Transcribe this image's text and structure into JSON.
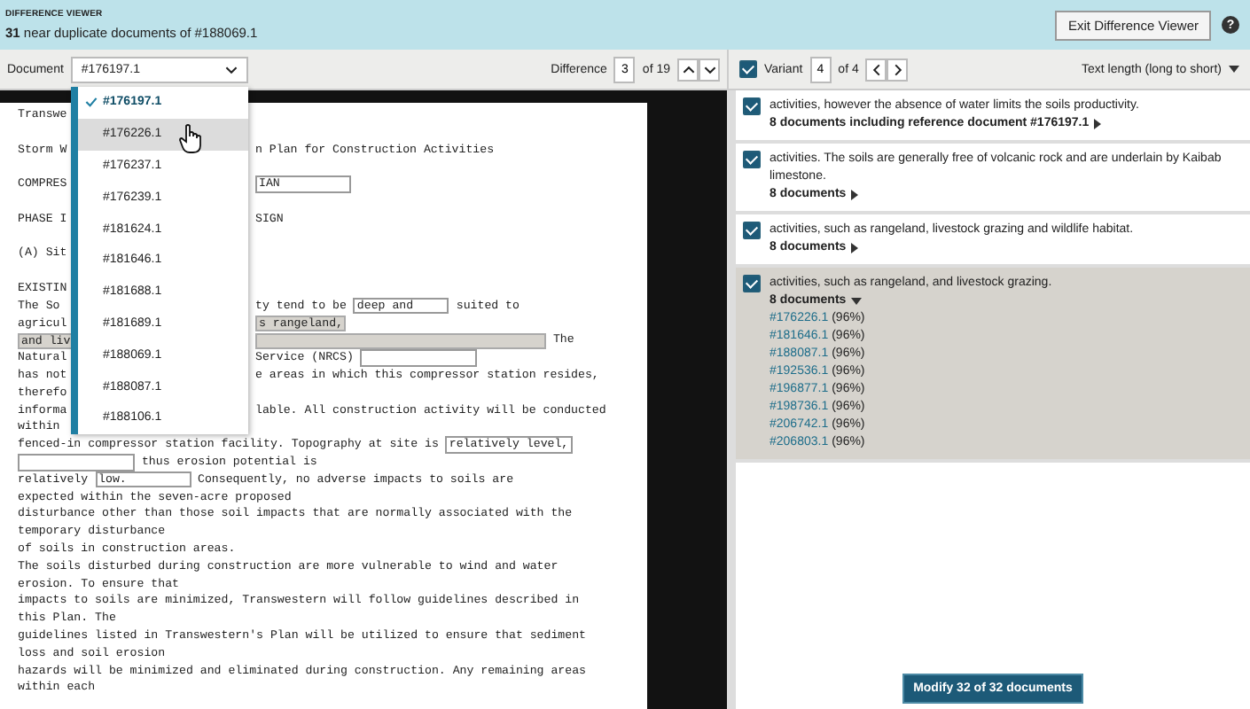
{
  "header": {
    "eyebrow": "DIFFERENCE VIEWER",
    "subtitle": "**31** near duplicate documents of #188069.1",
    "exit_button": "Exit Difference Viewer",
    "help": "?"
  },
  "toolbar": {
    "document_label": "Document",
    "document_value": "#176197.1",
    "difference_label": "Difference",
    "difference_value": "3",
    "difference_total": "of 19"
  },
  "variant_bar": {
    "checked": true,
    "label": "Variant",
    "value": "4",
    "total": "of 4",
    "sort": "Text length (long to short)"
  },
  "document_menu": [
    {
      "label": "#176197.1",
      "selected": true,
      "hovered": false
    },
    {
      "label": "#176226.1",
      "selected": false,
      "hovered": true
    },
    {
      "label": "#176237.1",
      "selected": false,
      "hovered": false
    },
    {
      "label": "#176239.1",
      "selected": false,
      "hovered": false
    },
    {
      "label": "#181624.1",
      "selected": false,
      "hovered": false
    },
    {
      "label": "#181646.1",
      "selected": false,
      "hovered": false
    },
    {
      "label": "#181688.1",
      "selected": false,
      "hovered": false
    },
    {
      "label": "#181689.1",
      "selected": false,
      "hovered": false
    },
    {
      "label": "#188069.1",
      "selected": false,
      "hovered": false
    },
    {
      "label": "#188087.1",
      "selected": false,
      "hovered": false
    },
    {
      "label": "#188106.1",
      "selected": false,
      "hovered": false
    }
  ],
  "document_lines": [
    {
      "kind": "split",
      "left": [
        {
          "kind": "plain",
          "text": "Transwe"
        }
      ]
    },
    {
      "kind": "blank"
    },
    {
      "kind": "split",
      "left": [
        {
          "kind": "plain",
          "text": "Storm W"
        }
      ],
      "right": [
        {
          "kind": "plain",
          "text": "n Plan for Construction Activities"
        }
      ]
    },
    {
      "kind": "blank"
    },
    {
      "kind": "split",
      "left": [
        {
          "kind": "plain",
          "text": "COMPRES"
        }
      ],
      "right": [
        {
          "kind": "box",
          "text": "IAN"
        }
      ]
    },
    {
      "kind": "blank"
    },
    {
      "kind": "split",
      "left": [
        {
          "kind": "plain",
          "text": "PHASE I"
        }
      ],
      "right": [
        {
          "kind": "plain",
          "text": "SIGN"
        }
      ]
    },
    {
      "kind": "blank"
    },
    {
      "kind": "split",
      "left": [
        {
          "kind": "plain",
          "text": "(A) Sit"
        }
      ]
    },
    {
      "kind": "blank"
    },
    {
      "kind": "split",
      "left": [
        {
          "kind": "plain",
          "text": "EXISTIN"
        }
      ]
    },
    {
      "kind": "split",
      "left": [
        {
          "kind": "plain",
          "text": "The So"
        }
      ],
      "right": [
        {
          "kind": "plain",
          "text": "ty tend to be "
        },
        {
          "kind": "box",
          "text": "deep and"
        },
        {
          "kind": "plain",
          "text": " suited to"
        }
      ]
    },
    {
      "kind": "split",
      "left": [
        {
          "kind": "plain",
          "text": "agricul"
        }
      ],
      "right": [
        {
          "kind": "changed",
          "text": "s rangeland,"
        }
      ]
    },
    {
      "kind": "split",
      "left": [
        {
          "kind": "changed",
          "text": "and liv"
        }
      ],
      "right": [
        {
          "kind": "changed-blank"
        },
        {
          "kind": "plain",
          "text": " The"
        }
      ]
    },
    {
      "kind": "split",
      "left": [
        {
          "kind": "plain",
          "text": "Natural"
        }
      ],
      "right": [
        {
          "kind": "plain",
          "text": "Service (NRCS) "
        },
        {
          "kind": "blank"
        }
      ]
    },
    {
      "kind": "split",
      "left": [
        {
          "kind": "plain",
          "text": "has not"
        }
      ],
      "right": [
        {
          "kind": "plain",
          "text": "e areas in which this compressor station resides,"
        }
      ]
    },
    {
      "kind": "split",
      "left": [
        {
          "kind": "plain",
          "text": "therefo"
        }
      ]
    },
    {
      "kind": "split",
      "left": [
        {
          "kind": "plain",
          "text": "informa"
        }
      ],
      "right": [
        {
          "kind": "plain",
          "text": "lable. All construction activity will be conducted"
        }
      ]
    },
    {
      "kind": "split",
      "left": [
        {
          "kind": "plain",
          "text": "within"
        }
      ]
    },
    {
      "kind": "full",
      "segments": [
        {
          "kind": "plain",
          "text": "fenced-in compressor station facility. Topography at site is "
        },
        {
          "kind": "box",
          "text": "relatively level,"
        }
      ]
    },
    {
      "kind": "full",
      "segments": [
        {
          "kind": "blank"
        },
        {
          "kind": "plain",
          "text": " thus erosion potential is"
        }
      ]
    },
    {
      "kind": "full",
      "segments": [
        {
          "kind": "plain",
          "text": "relatively "
        },
        {
          "kind": "box",
          "text": "low.      "
        },
        {
          "kind": "plain",
          "text": " Consequently, no adverse impacts to soils are"
        }
      ]
    },
    {
      "kind": "full",
      "segments": [
        {
          "kind": "plain",
          "text": "expected within the seven-acre proposed"
        }
      ]
    },
    {
      "kind": "full",
      "segments": [
        {
          "kind": "plain",
          "text": "disturbance other than those soil impacts that are normally associated with the"
        }
      ]
    },
    {
      "kind": "full",
      "segments": [
        {
          "kind": "plain",
          "text": "temporary disturbance"
        }
      ]
    },
    {
      "kind": "full",
      "segments": [
        {
          "kind": "plain",
          "text": "of soils in construction areas."
        }
      ]
    },
    {
      "kind": "full",
      "segments": [
        {
          "kind": "plain",
          "text": "The soils disturbed during construction are more vulnerable to wind and water"
        }
      ]
    },
    {
      "kind": "full",
      "segments": [
        {
          "kind": "plain",
          "text": "erosion. To ensure that"
        }
      ]
    },
    {
      "kind": "full",
      "segments": [
        {
          "kind": "plain",
          "text": "impacts to soils are minimized, Transwestern will follow guidelines described in"
        }
      ]
    },
    {
      "kind": "full",
      "segments": [
        {
          "kind": "plain",
          "text": "this Plan. The"
        }
      ]
    },
    {
      "kind": "full",
      "segments": [
        {
          "kind": "plain",
          "text": "guidelines listed in Transwestern's Plan will be utilized to ensure that sediment"
        }
      ]
    },
    {
      "kind": "full",
      "segments": [
        {
          "kind": "plain",
          "text": "loss and soil erosion"
        }
      ]
    },
    {
      "kind": "full",
      "segments": [
        {
          "kind": "plain",
          "text": "hazards will be minimized and eliminated during construction. Any remaining areas"
        }
      ]
    },
    {
      "kind": "full",
      "segments": [
        {
          "kind": "plain",
          "text": "within each"
        }
      ]
    }
  ],
  "variants": [
    {
      "checked": true,
      "expanded": false,
      "text": "activities, however the absence of water limits the soils productivity.",
      "summary": "8 documents including reference document #176197.1"
    },
    {
      "checked": true,
      "expanded": false,
      "text": "activities. The soils are generally free of volcanic rock and are underlain by Kaibab limestone.",
      "summary": "8 documents"
    },
    {
      "checked": true,
      "expanded": false,
      "text": "activities, such as rangeland, livestock grazing and wildlife habitat.",
      "summary": "8 documents"
    },
    {
      "checked": true,
      "expanded": true,
      "text": "activities, such as rangeland, and livestock grazing.",
      "summary": "8 documents",
      "documents": [
        {
          "id": "#176226.1",
          "score": "(96%)"
        },
        {
          "id": "#181646.1",
          "score": "(96%)"
        },
        {
          "id": "#188087.1",
          "score": "(96%)"
        },
        {
          "id": "#192536.1",
          "score": "(96%)"
        },
        {
          "id": "#196877.1",
          "score": "(96%)"
        },
        {
          "id": "#198736.1",
          "score": "(96%)"
        },
        {
          "id": "#206742.1",
          "score": "(96%)"
        },
        {
          "id": "#206803.1",
          "score": "(96%)"
        }
      ]
    }
  ],
  "modify_button": "Modify 32 of 32 documents"
}
